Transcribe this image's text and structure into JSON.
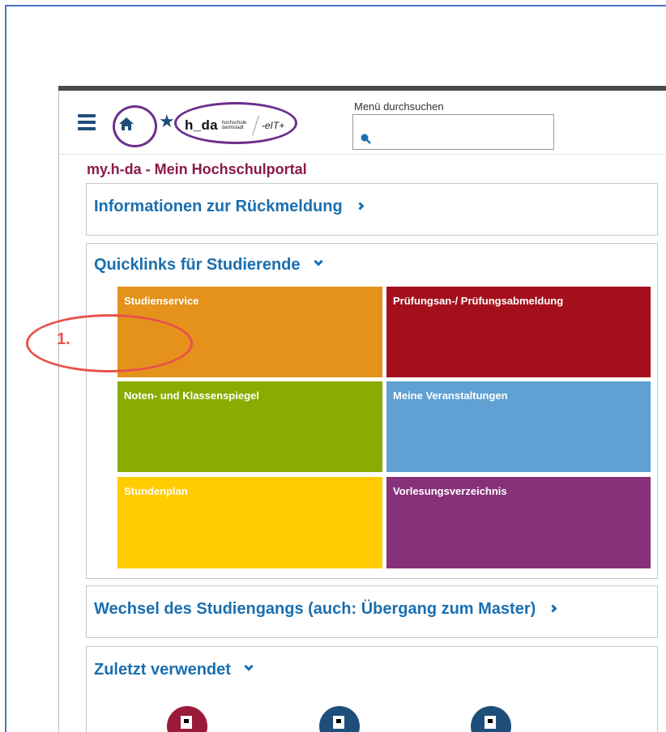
{
  "header": {
    "logo_main": "h_da",
    "logo_sub": "hochschule darmstadt",
    "logo_partner": "-eIT+",
    "search_label": "Menü durchsuchen",
    "search_placeholder": ""
  },
  "page_title": "my.h-da - Mein Hochschulportal",
  "panels": {
    "info": {
      "title": "Informationen zur Rückmeldung"
    },
    "quicklinks": {
      "title": "Quicklinks für Studierende"
    },
    "wechsel": {
      "title": "Wechsel des Studiengangs (auch: Übergang zum Master)"
    },
    "zuletzt": {
      "title": "Zuletzt verwendet"
    }
  },
  "tiles": [
    {
      "label": "Studienservice",
      "color": "#e4921c"
    },
    {
      "label": "Prüfungsan-/ Prüfungsabmeldung",
      "color": "#a3101c"
    },
    {
      "label": "Noten- und Klassenspiegel",
      "color": "#8aab00"
    },
    {
      "label": "Meine Veranstaltungen",
      "color": "#60a0d2"
    },
    {
      "label": "Stundenplan",
      "color": "#ffcc00"
    },
    {
      "label": "Vorlesungsverzeichnis",
      "color": "#86317a"
    }
  ],
  "annotation": {
    "step_label": "1."
  },
  "icons": {
    "menu": "hamburger-icon",
    "home": "home-icon",
    "star": "star-icon",
    "search": "search-icon",
    "recent": [
      "document-icon",
      "calendar-icon",
      "calendar-icon"
    ]
  },
  "colors": {
    "brand_title": "#8b1a4a",
    "link_blue": "#1a6fb0",
    "annotation_purple": "#6d2e8c",
    "annotation_red": "#e8524a"
  }
}
